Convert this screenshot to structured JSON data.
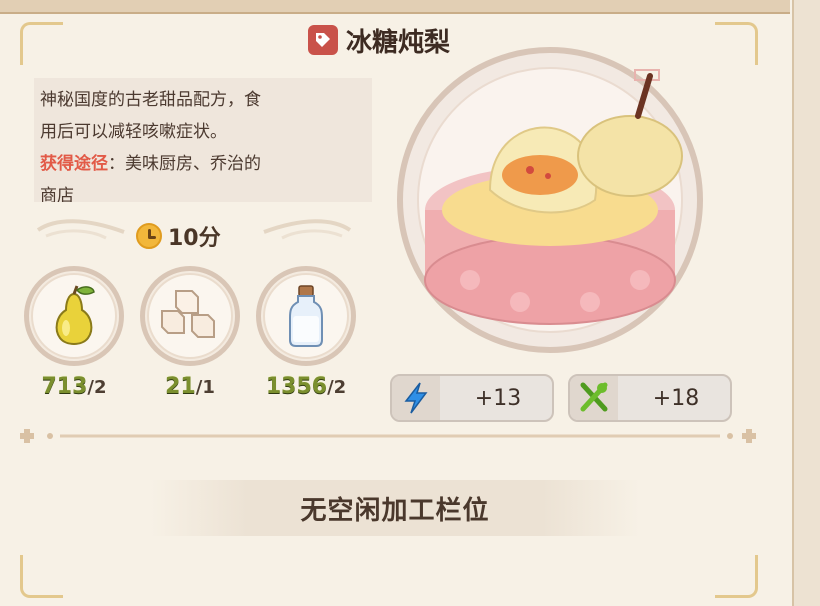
{
  "recipe": {
    "title": "冰糖炖梨",
    "description_line1": "神秘国度的古老甜品配方，食",
    "description_line2": "用后可以减轻咳嗽症状。",
    "source_label": "获得途径",
    "source_text": "：美味厨房、乔治的",
    "source_text_cut": "商店",
    "time": "10分"
  },
  "ingredients": [
    {
      "icon": "pear-icon",
      "owned": "713",
      "required": "/2"
    },
    {
      "icon": "sugar-cubes-icon",
      "owned": "21",
      "required": "/1"
    },
    {
      "icon": "milk-bottle-icon",
      "owned": "1356",
      "required": "/2"
    }
  ],
  "stats": [
    {
      "icon": "lightning-icon",
      "value": "+13"
    },
    {
      "icon": "fork-spoon-icon",
      "value": "+18"
    }
  ],
  "status": {
    "text": "无空闲加工栏位"
  },
  "colors": {
    "background": "#f7f1e6",
    "accent_red": "#e25a47",
    "count_green": "#7b8f2e",
    "frame_gold": "#e3c88d"
  }
}
